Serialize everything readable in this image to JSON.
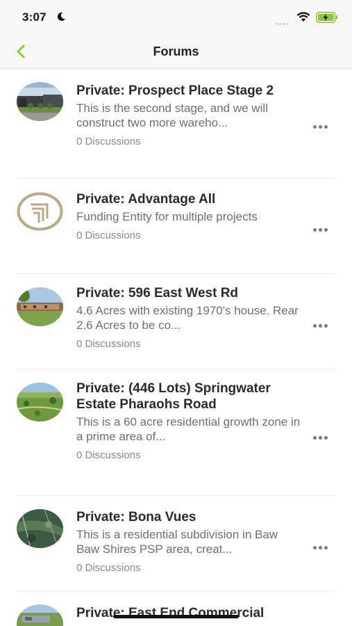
{
  "status_bar": {
    "time": "3:07"
  },
  "nav": {
    "title": "Forums",
    "back_icon": "chevron-left-icon",
    "accent_color": "#8cc63f"
  },
  "forums": [
    {
      "title": "Private: Prospect Place Stage 2",
      "description": "This is the second stage, and we will construct two more wareho...",
      "discussions": "0 Discussions",
      "thumb": "warehouse-photo"
    },
    {
      "title": "Private: Advantage All",
      "description": "Funding Entity for multiple projects",
      "discussions": "0 Discussions",
      "thumb": "advantage-logo"
    },
    {
      "title": "Private: 596 East West Rd",
      "description": "4.6 Acres with existing 1970's house. Rear 2.6 Acres to be co...",
      "discussions": "0 Discussions",
      "thumb": "house-photo"
    },
    {
      "title": "Private: (446 Lots) Springwater Estate Pharaohs Road",
      "description": "This is a 60 acre residential growth zone in a prime area of...",
      "discussions": "0 Discussions",
      "thumb": "aerial-land-photo"
    },
    {
      "title": "Private: Bona Vues",
      "description": "This is a residential subdivision in Baw Baw Shires PSP area, creat...",
      "discussions": "0 Discussions",
      "thumb": "aerial-map-photo"
    },
    {
      "title": "Private: East End Commercial",
      "description": "",
      "discussions": "",
      "thumb": "commercial-site-photo"
    }
  ]
}
